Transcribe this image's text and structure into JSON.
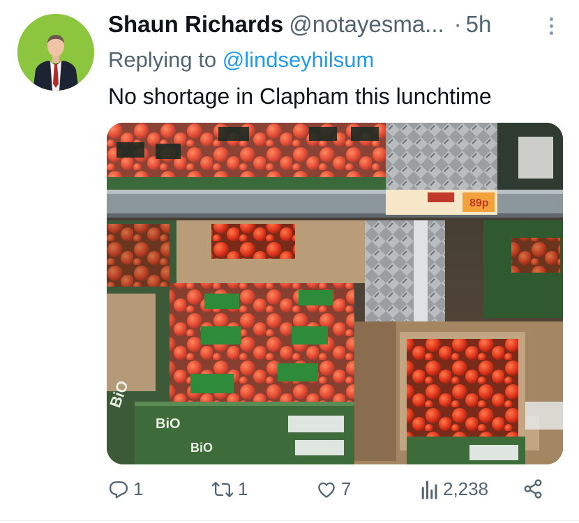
{
  "tweet": {
    "author_name": "Shaun Richards",
    "author_handle": "@notayesma...",
    "separator": "·",
    "time_ago": "5h",
    "replying_prefix": "Replying to",
    "replying_to": "@lindseyhilsum",
    "text": "No shortage in Clapham this lunchtime"
  },
  "actions": {
    "replies": "1",
    "retweets": "1",
    "likes": "7",
    "views": "2,238"
  },
  "icons": {
    "reply": "reply-icon",
    "retweet": "retweet-icon",
    "like": "heart-icon",
    "views": "views-icon",
    "share": "share-icon",
    "more": "more-options-icon"
  },
  "colors": {
    "link": "#1d9bf0",
    "secondary_text": "#536471",
    "avatar_bg": "#8cc63f"
  }
}
